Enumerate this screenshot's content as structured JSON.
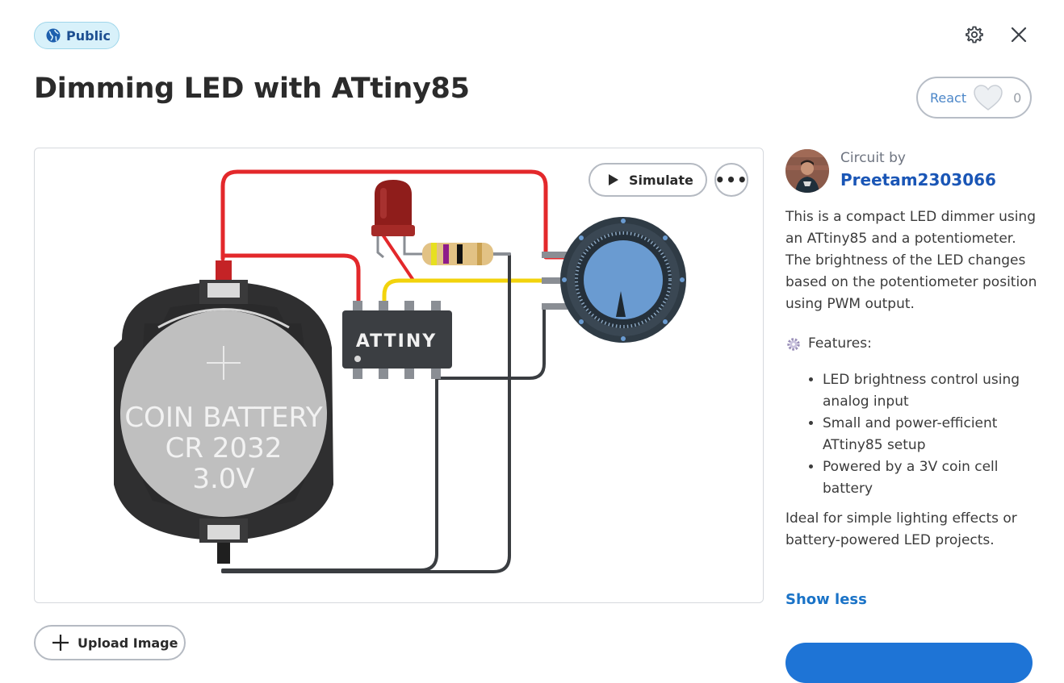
{
  "header": {
    "visibility_badge": "Public",
    "title": "Dimming LED with ATtiny85",
    "settings_icon": "gear-icon",
    "close_icon": "close-icon"
  },
  "reaction": {
    "label": "React",
    "count": "0",
    "icon": "heart-icon"
  },
  "canvas": {
    "simulate_label": "Simulate",
    "more_label": "•••",
    "battery_text": [
      "COIN BATTERY",
      "CR 2032",
      "3.0V"
    ],
    "chip_label": "ATTINY"
  },
  "sidebar": {
    "byline": "Circuit by",
    "author": "Preetam2303066",
    "description": "This is a compact LED dimmer using an ATtiny85 and a potentiometer. The brightness of the LED changes based on the potentiometer position using PWM output.",
    "features_heading": "Features:",
    "features": [
      "LED brightness control using analog input",
      "Small and power-efficient ATtiny85 setup",
      "Powered by a 3V coin cell battery"
    ],
    "closing": "Ideal for simple lighting effects or battery-powered LED projects.",
    "show_less": "Show less"
  },
  "actions": {
    "upload_label": "Upload Image"
  },
  "colors": {
    "accent": "#1e74d6",
    "author_link": "#1a56b6",
    "badge_bg": "#d8f1fa",
    "wire_red": "#e3282b",
    "wire_yellow": "#f2d30c",
    "wire_black": "#3a3d41",
    "knob_blue": "#6a9bd1"
  }
}
